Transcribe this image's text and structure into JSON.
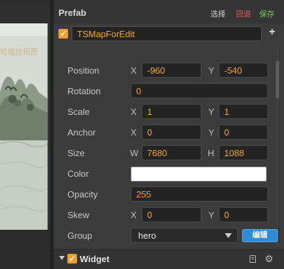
{
  "scene": {
    "caption": "轮缩放视图"
  },
  "prefab": {
    "title": "Prefab",
    "select_label": "选择",
    "revert_label": "回退",
    "save_label": "保存"
  },
  "node": {
    "name": "TSMapForEdit",
    "add_label": "+"
  },
  "properties": {
    "position": {
      "label": "Position",
      "x_axis": "X",
      "y_axis": "Y",
      "x": "-960",
      "y": "-540"
    },
    "rotation": {
      "label": "Rotation",
      "value": "0"
    },
    "scale": {
      "label": "Scale",
      "x_axis": "X",
      "y_axis": "Y",
      "x": "1",
      "y": "1"
    },
    "anchor": {
      "label": "Anchor",
      "x_axis": "X",
      "y_axis": "Y",
      "x": "0",
      "y": "0"
    },
    "size": {
      "label": "Size",
      "w_axis": "W",
      "h_axis": "H",
      "w": "7680",
      "h": "1088"
    },
    "color": {
      "label": "Color",
      "value": "#ffffff"
    },
    "opacity": {
      "label": "Opacity",
      "value": "255"
    },
    "skew": {
      "label": "Skew",
      "x_axis": "X",
      "y_axis": "Y",
      "x": "0",
      "y": "0"
    },
    "group": {
      "label": "Group",
      "value": "hero",
      "edit_label": "编辑"
    }
  },
  "widget": {
    "title": "Widget",
    "checked": true
  },
  "icons": {
    "checkbox": "check-icon",
    "dropdown": "chevron-down-icon",
    "collapse": "triangle-down-icon",
    "docs": "book-icon",
    "settings": "gear-icon"
  },
  "colors": {
    "accent": "#f5a623",
    "checkbox": "#f0a02e",
    "revert": "#e25c5c",
    "save": "#79c75a",
    "edit_button": "#2f8bd6"
  }
}
